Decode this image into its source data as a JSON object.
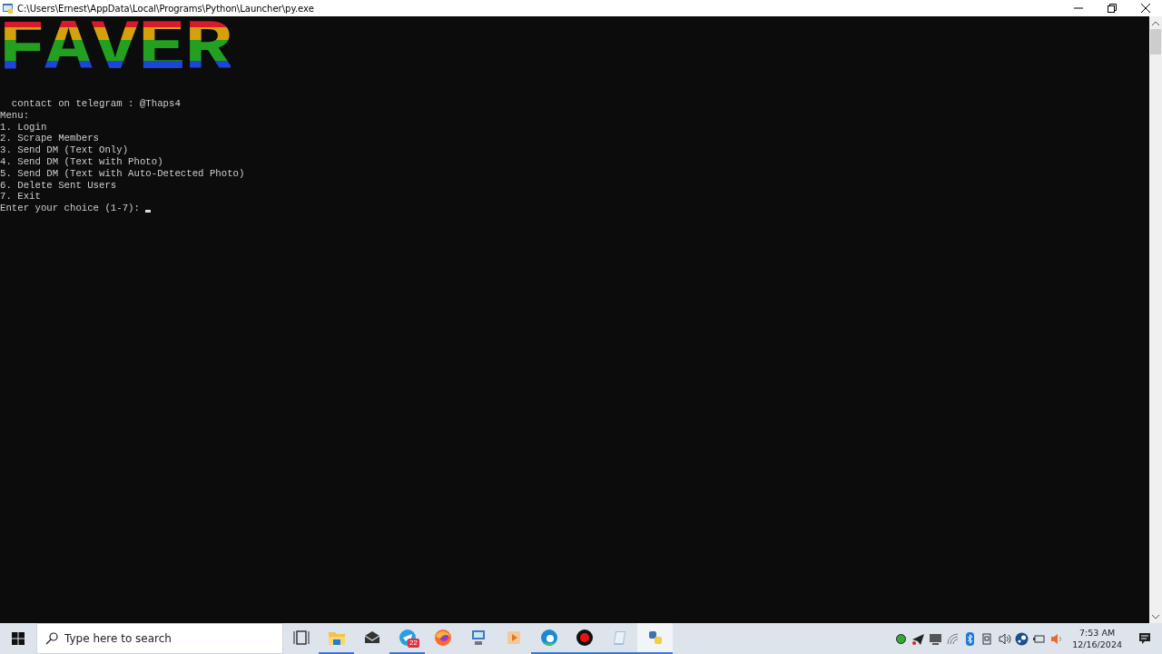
{
  "window": {
    "title": "C:\\Users\\Ernest\\AppData\\Local\\Programs\\Python\\Launcher\\py.exe"
  },
  "console": {
    "banner": "FAVER",
    "lines": [
      "  contact on telegram : @Thaps4",
      "Menu:",
      "1. Login",
      "2. Scrape Members",
      "3. Send DM (Text Only)",
      "4. Send DM (Text with Photo)",
      "5. Send DM (Text with Auto-Detected Photo)",
      "6. Delete Sent Users",
      "7. Exit"
    ],
    "prompt": "Enter your choice (1-7): "
  },
  "taskbar": {
    "search": {
      "placeholder": "Type here to search"
    },
    "apps": [
      {
        "kind": "taskview",
        "running": false,
        "selected": false
      },
      {
        "kind": "folder",
        "running": true,
        "selected": false
      },
      {
        "kind": "mail",
        "running": false,
        "selected": false
      },
      {
        "kind": "telegram",
        "running": true,
        "selected": false,
        "badge": "22"
      },
      {
        "kind": "firefox",
        "running": false,
        "selected": false
      },
      {
        "kind": "computer",
        "running": false,
        "selected": false
      },
      {
        "kind": "media",
        "running": false,
        "selected": false
      },
      {
        "kind": "edge",
        "running": true,
        "selected": false
      },
      {
        "kind": "record",
        "running": true,
        "selected": false
      },
      {
        "kind": "notepad",
        "running": true,
        "selected": false
      },
      {
        "kind": "python",
        "running": true,
        "selected": true
      }
    ],
    "clock": {
      "time": "7:53 AM",
      "date": "12/16/2024"
    }
  }
}
